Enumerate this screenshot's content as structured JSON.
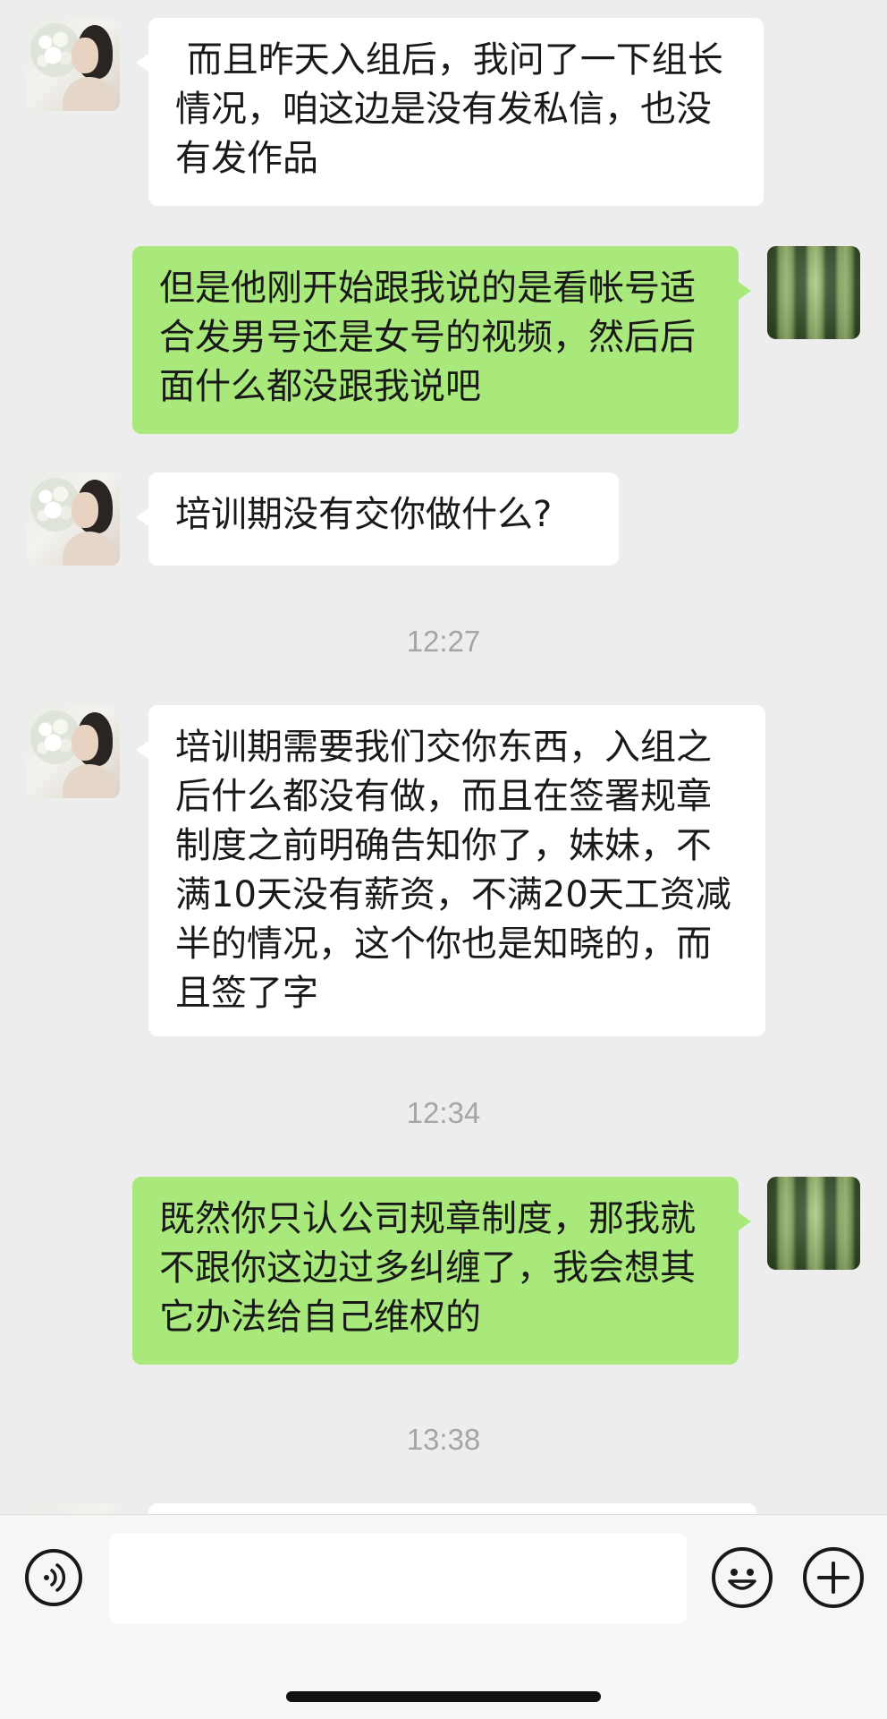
{
  "messages": [
    {
      "sender": "other",
      "text": " 而且昨天入组后，我问了一下组长情况，咱这边是没有发私信，也没有发作品"
    },
    {
      "sender": "me",
      "text": "但是他刚开始跟我说的是看帐号适合发男号还是女号的视频，然后后面什么都没跟我说吧"
    },
    {
      "sender": "other",
      "text": "培训期没有交你做什么?"
    },
    {
      "sender": "other",
      "text": "培训期需要我们交你东西，入组之后什么都没有做，而且在签署规章制度之前明确告知你了，妹妹，不满10天没有薪资，不满20天工资减半的情况，这个你也是知晓的，而且签了字"
    },
    {
      "sender": "me",
      "text": "既然你只认公司规章制度，那我就不跟你这边过多纠缠了，我会想其它办法给自己维权的"
    }
  ],
  "timestamps": [
    "12:27",
    "12:34",
    "13:38"
  ],
  "avatars": {
    "other": "woman-with-flowers-photo",
    "me": "watermelon-photo"
  },
  "input_bar": {
    "voice_icon": "voice-icon",
    "emoji_icon": "emoji-icon",
    "more_icon": "plus-icon",
    "input_value": ""
  },
  "colors": {
    "background": "#ededed",
    "bubble_me": "#a9e97b",
    "bubble_other": "#ffffff",
    "timestamp": "#a5a5a5"
  }
}
